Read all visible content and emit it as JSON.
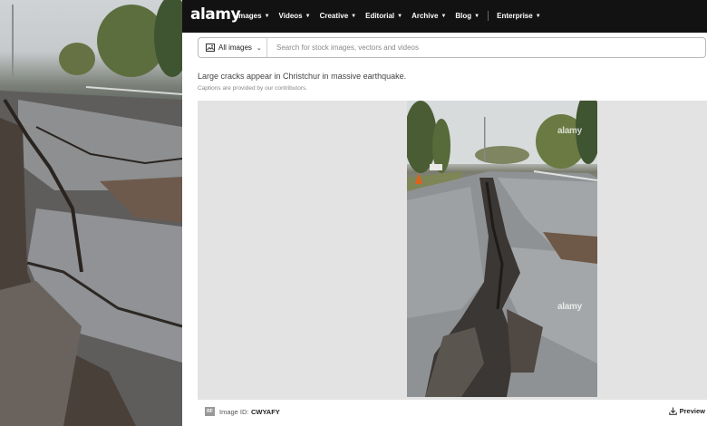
{
  "header": {
    "logo": "alamy",
    "nav": [
      {
        "label": "Images"
      },
      {
        "label": "Videos"
      },
      {
        "label": "Creative"
      },
      {
        "label": "Editorial"
      },
      {
        "label": "Archive"
      },
      {
        "label": "Blog"
      },
      {
        "label": "Enterprise"
      }
    ],
    "chevron_icon": "chevron-down-icon"
  },
  "search": {
    "filter_label": "All images",
    "filter_icon": "image-icon",
    "placeholder": "Search for stock images, vectors and videos"
  },
  "caption": {
    "title": "Large cracks appear in Christchur in massive earthquake.",
    "subtitle": "Captions are provided by our contributors."
  },
  "preview": {
    "watermark_top": "alamy",
    "watermark_bottom": "alamy"
  },
  "info_bar": {
    "badge": "RF",
    "image_id_label": "Image ID:",
    "image_id_value": "CWYAFY",
    "preview_label": "Preview",
    "preview_icon": "download-icon"
  },
  "colors": {
    "header_bg": "#121212",
    "preview_bg": "#e3e3e3"
  }
}
